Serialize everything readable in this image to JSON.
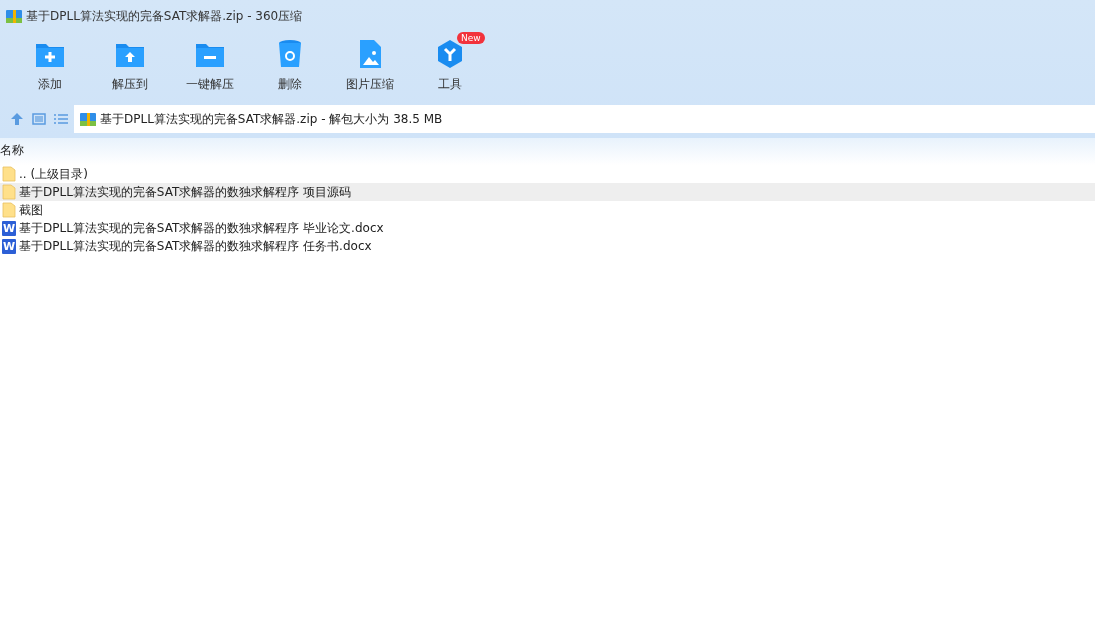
{
  "window": {
    "title": "基于DPLL算法实现的完备SAT求解器.zip - 360压缩"
  },
  "toolbar": [
    {
      "kind": "add",
      "label": "添加"
    },
    {
      "kind": "extract-to",
      "label": "解压到"
    },
    {
      "kind": "one-click",
      "label": "一键解压"
    },
    {
      "kind": "delete",
      "label": "删除"
    },
    {
      "kind": "image",
      "label": "图片压缩"
    },
    {
      "kind": "tools",
      "label": "工具",
      "badge": "New"
    }
  ],
  "address": {
    "text": "基于DPLL算法实现的完备SAT求解器.zip - 解包大小为 38.5 MB"
  },
  "table": {
    "columns": [
      "名称"
    ],
    "rows": [
      {
        "kind": "folder",
        "name": ".. (上级目录)",
        "selected": false
      },
      {
        "kind": "folder",
        "name": "基于DPLL算法实现的完备SAT求解器的数独求解程序 项目源码",
        "selected": true
      },
      {
        "kind": "folder",
        "name": "截图",
        "selected": false
      },
      {
        "kind": "docx",
        "icon_letter": "W",
        "name": "基于DPLL算法实现的完备SAT求解器的数独求解程序 毕业论文.docx",
        "selected": false
      },
      {
        "kind": "docx",
        "icon_letter": "W",
        "name": "基于DPLL算法实现的完备SAT求解器的数独求解程序 任务书.docx",
        "selected": false
      }
    ]
  }
}
